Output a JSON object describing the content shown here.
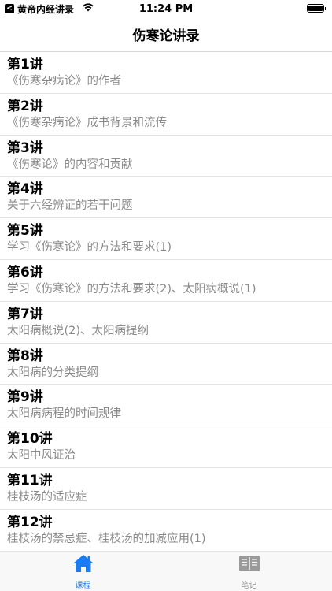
{
  "status_bar": {
    "back_app": "黄帝内经讲录",
    "back_badge": "<",
    "time": "11:24 PM"
  },
  "nav": {
    "title": "伤寒论讲录"
  },
  "lectures": [
    {
      "title": "第1讲",
      "subtitle": "《伤寒杂病论》的作者"
    },
    {
      "title": "第2讲",
      "subtitle": "《伤寒杂病论》成书背景和流传"
    },
    {
      "title": "第3讲",
      "subtitle": "《伤寒论》的内容和贡献"
    },
    {
      "title": "第4讲",
      "subtitle": "关于六经辨证的若干问题"
    },
    {
      "title": "第5讲",
      "subtitle": "学习《伤寒论》的方法和要求(1)"
    },
    {
      "title": "第6讲",
      "subtitle": "学习《伤寒论》的方法和要求(2)、太阳病概说(1)"
    },
    {
      "title": "第7讲",
      "subtitle": "太阳病概说(2)、太阳病提纲"
    },
    {
      "title": "第8讲",
      "subtitle": "太阳病的分类提纲"
    },
    {
      "title": "第9讲",
      "subtitle": "太阳病病程的时间规律"
    },
    {
      "title": "第10讲",
      "subtitle": "太阳中风证治"
    },
    {
      "title": "第11讲",
      "subtitle": "桂枝汤的适应症"
    },
    {
      "title": "第12讲",
      "subtitle": "桂枝汤的禁忌症、桂枝汤的加减应用(1)"
    }
  ],
  "tabs": [
    {
      "label": "课程",
      "icon": "home-icon",
      "active": true
    },
    {
      "label": "笔记",
      "icon": "notes-icon",
      "active": false
    }
  ],
  "colors": {
    "accent": "#1a7cf5",
    "inactive": "#8e8e8e",
    "subtitle": "#8a8a8a"
  }
}
